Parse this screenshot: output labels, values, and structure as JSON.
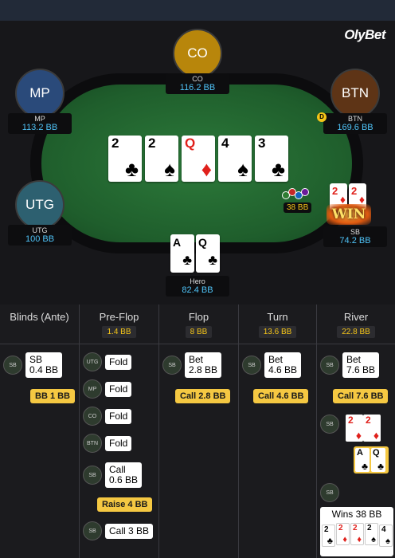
{
  "brand": "OlyBet",
  "seats": [
    {
      "id": "co",
      "label": "CO",
      "pos": "CO",
      "stack": "116.2 BB"
    },
    {
      "id": "mp",
      "label": "MP",
      "pos": "MP",
      "stack": "113.2 BB"
    },
    {
      "id": "btn",
      "label": "BTN",
      "pos": "BTN",
      "stack": "169.6 BB"
    },
    {
      "id": "utg",
      "label": "UTG",
      "pos": "UTG",
      "stack": "100 BB"
    },
    {
      "id": "sb",
      "pos": "SB",
      "stack": "74.2 BB"
    },
    {
      "id": "hero",
      "pos": "Hero",
      "stack": "82.4 BB"
    }
  ],
  "dealer_button": "D",
  "board": [
    {
      "rank": "2",
      "suit": "♣",
      "color": "#000000"
    },
    {
      "rank": "2",
      "suit": "♠",
      "color": "#000000"
    },
    {
      "rank": "Q",
      "suit": "♦",
      "color": "#e0201b"
    },
    {
      "rank": "4",
      "suit": "♠",
      "color": "#000000"
    },
    {
      "rank": "3",
      "suit": "♣",
      "color": "#000000"
    }
  ],
  "hero_cards": [
    {
      "rank": "A",
      "suit": "♣"
    },
    {
      "rank": "Q",
      "suit": "♣"
    }
  ],
  "sb_cards": [
    {
      "rank": "2",
      "suit": "♦"
    },
    {
      "rank": "2",
      "suit": "♦"
    }
  ],
  "pot": "38 BB",
  "win_label": "WIN",
  "history": {
    "columns": [
      {
        "title": "Blinds (Ante)",
        "pot": ""
      },
      {
        "title": "Pre-Flop",
        "pot": "1.4 BB"
      },
      {
        "title": "Flop",
        "pot": "8 BB"
      },
      {
        "title": "Turn",
        "pot": "13.6 BB"
      },
      {
        "title": "River",
        "pot": "22.8 BB"
      }
    ],
    "blinds": {
      "sb_line1": "SB",
      "sb_line2": "0.4 BB",
      "bb": "BB 1 BB"
    },
    "preflop": {
      "utg": "Fold",
      "mp": "Fold",
      "co": "Fold",
      "btn": "Fold",
      "sb_line1": "Call",
      "sb_line2": "0.6 BB",
      "raise": "Raise 4 BB",
      "sb_call": "Call 3 BB"
    },
    "flop": {
      "bet_line1": "Bet",
      "bet_line2": "2.8 BB",
      "call": "Call 2.8 BB"
    },
    "turn": {
      "bet_line1": "Bet",
      "bet_line2": "4.6 BB",
      "call": "Call 4.6 BB"
    },
    "river": {
      "bet_line1": "Bet",
      "bet_line2": "7.6 BB",
      "call": "Call 7.6 BB",
      "wins": "Wins 38 BB"
    },
    "seat_chip_labels": {
      "sb": "SB",
      "utg": "UTG",
      "mp": "MP",
      "co": "CO",
      "btn": "BTN"
    }
  },
  "colors": {
    "accent": "#f5c842",
    "stack": "#4fc3f7",
    "felt": "#1f5e2c"
  }
}
